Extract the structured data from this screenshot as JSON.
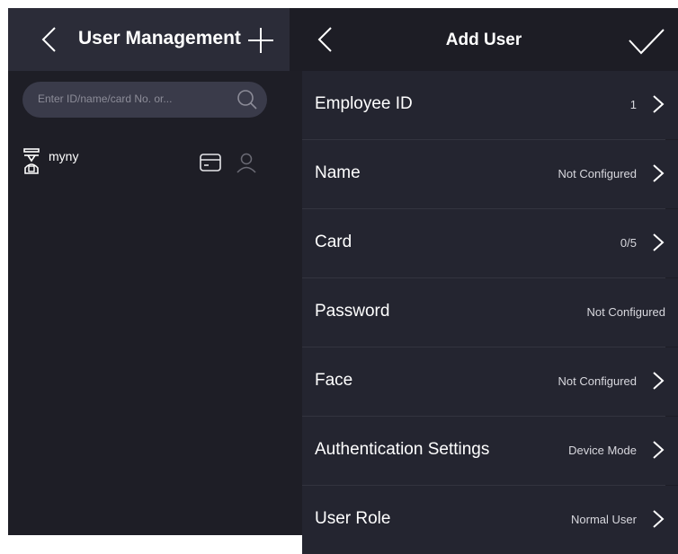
{
  "left_panel": {
    "title": "User Management",
    "search_placeholder": "Enter ID/name/card No. or...",
    "users": [
      {
        "name": "myny"
      }
    ]
  },
  "right_panel": {
    "title": "Add User",
    "rows": [
      {
        "label": "Employee ID",
        "value": "1"
      },
      {
        "label": "Name",
        "value": "Not Configured"
      },
      {
        "label": "Card",
        "value": "0/5"
      },
      {
        "label": "Password",
        "value": "Not Configured"
      },
      {
        "label": "Face",
        "value": "Not Configured"
      },
      {
        "label": "Authentication Settings",
        "value": "Device Mode"
      },
      {
        "label": "User Role",
        "value": "Normal User"
      }
    ]
  },
  "colors": {
    "background": "#1e1e26",
    "header": "#2b2c38",
    "row": "#242530",
    "text": "#ffffff",
    "muted": "#8c8c98"
  },
  "icons": [
    "back-icon",
    "plus-icon",
    "search-icon",
    "user-icon",
    "card-icon",
    "face-icon",
    "checkmark-icon",
    "chevron-right-icon"
  ]
}
